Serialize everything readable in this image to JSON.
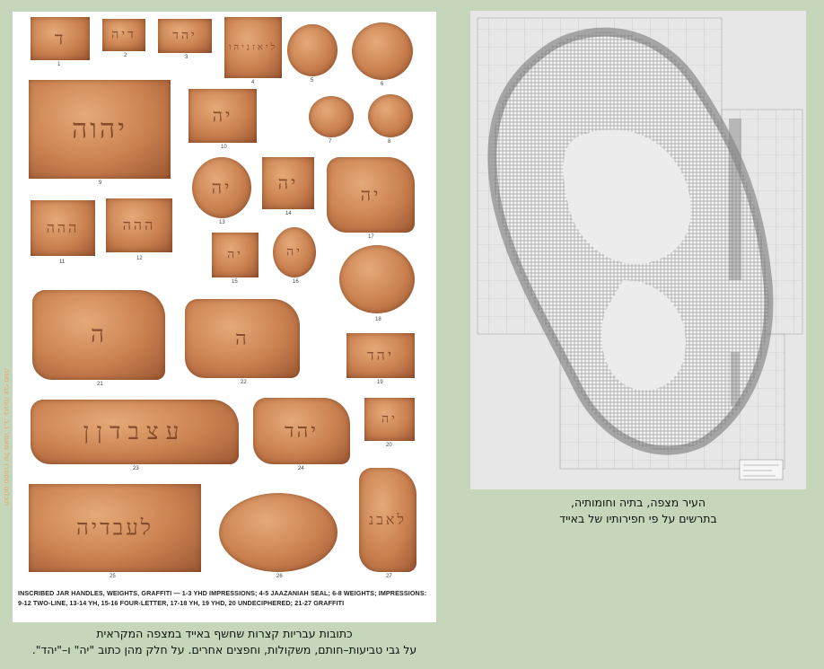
{
  "left_caption": {
    "line1": "כתובות עבריות קצרות שחשף באייד במצפה המקראית",
    "line2": "על גבי טביעות–חותם, משקולות, וחפצים אחרים. על חלק מהן כתוב \"יה\" ו–\"יהד\"."
  },
  "right_caption": {
    "line1": "העיר מצפה, בתיה וחומותיה,",
    "line2": "בתרשים על פי חפירותיו של באייד"
  },
  "vertical_credit": "תצלום מספרו של מאמר נ.ב. בוגעה צבי מפה",
  "plate_caption": "INSCRIBED JAR HANDLES, WEIGHTS, GRAFFITI — 1-3 YHD IMPRESSIONS; 4-5 JAAZANIAH SEAL; 6-8 WEIGHTS; IMPRESSIONS: 9-12 TWO-LINE, 13-14 YH, 15-16 FOUR-LETTER, 17-18 YH, 19 YHD, 20 UNDECIPHERED; 21-27 GRAFFITI",
  "artifacts": [
    {
      "n": "1",
      "g": "ד"
    },
    {
      "n": "2",
      "g": "דיה"
    },
    {
      "n": "3",
      "g": "יהד"
    },
    {
      "n": "4",
      "g": "ליאזניהו"
    },
    {
      "n": "5",
      "g": ""
    },
    {
      "n": "6",
      "g": ""
    },
    {
      "n": "7",
      "g": ""
    },
    {
      "n": "8",
      "g": ""
    },
    {
      "n": "9",
      "g": "יהוה"
    },
    {
      "n": "10",
      "g": "יה"
    },
    {
      "n": "11",
      "g": "ההה"
    },
    {
      "n": "12",
      "g": "ההה"
    },
    {
      "n": "13",
      "g": "יה"
    },
    {
      "n": "14",
      "g": "יה"
    },
    {
      "n": "15",
      "g": "יה"
    },
    {
      "n": "16",
      "g": "יה"
    },
    {
      "n": "17",
      "g": "יה"
    },
    {
      "n": "18",
      "g": ""
    },
    {
      "n": "19",
      "g": "יהד"
    },
    {
      "n": "20",
      "g": "יה"
    },
    {
      "n": "21",
      "g": "ה"
    },
    {
      "n": "22",
      "g": "ה"
    },
    {
      "n": "23",
      "g": "עצבדןן"
    },
    {
      "n": "24",
      "g": "יהד"
    },
    {
      "n": "25",
      "g": "לעבדיה"
    },
    {
      "n": "26",
      "g": ""
    },
    {
      "n": "27",
      "g": "לאבנ"
    }
  ]
}
